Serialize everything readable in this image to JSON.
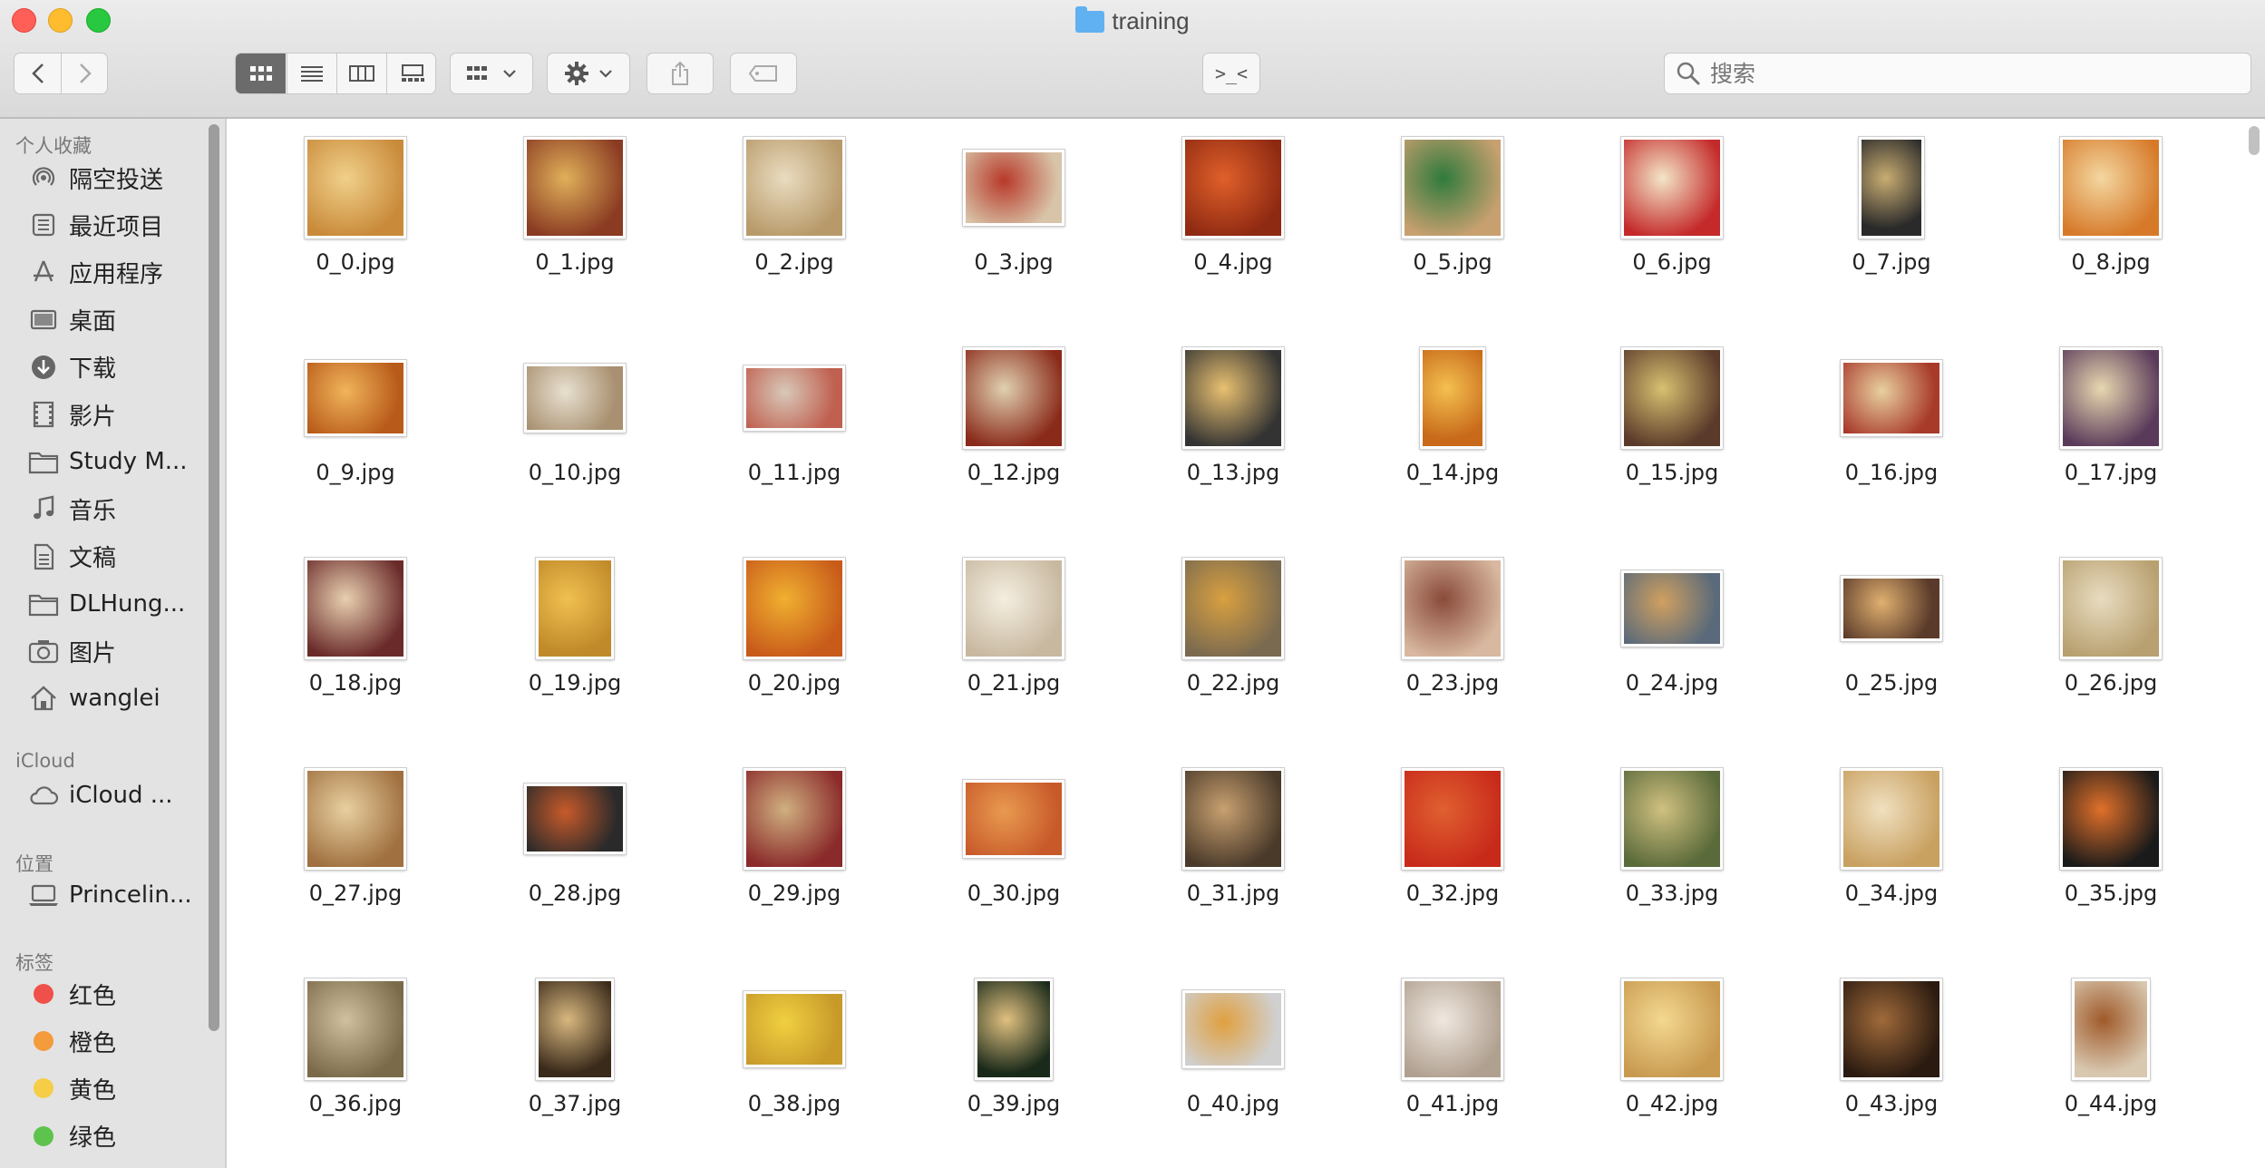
{
  "window": {
    "title": "training"
  },
  "toolbar": {
    "back_symbol": "‹",
    "forward_symbol": "›",
    "terminal_label": ">_<",
    "search": {
      "placeholder": "搜索",
      "value": ""
    }
  },
  "sidebar": {
    "sections": [
      {
        "heading": "个人收藏",
        "items": [
          {
            "label": "隔空投送",
            "icon": "airdrop-icon"
          },
          {
            "label": "最近项目",
            "icon": "recents-icon"
          },
          {
            "label": "应用程序",
            "icon": "applications-icon"
          },
          {
            "label": "桌面",
            "icon": "desktop-icon"
          },
          {
            "label": "下载",
            "icon": "downloads-icon"
          },
          {
            "label": "影片",
            "icon": "movies-icon"
          },
          {
            "label": "Study M...",
            "icon": "folder-icon"
          },
          {
            "label": "音乐",
            "icon": "music-icon"
          },
          {
            "label": "文稿",
            "icon": "documents-icon"
          },
          {
            "label": "DLHung...",
            "icon": "folder-icon"
          },
          {
            "label": "图片",
            "icon": "pictures-icon"
          },
          {
            "label": "wanglei",
            "icon": "home-icon"
          }
        ]
      },
      {
        "heading": "iCloud",
        "items": [
          {
            "label": "iCloud ...",
            "icon": "icloud-icon"
          }
        ]
      },
      {
        "heading": "位置",
        "items": [
          {
            "label": "Princelin...",
            "icon": "laptop-icon"
          }
        ]
      },
      {
        "heading": "标签",
        "items": [
          {
            "label": "红色",
            "icon": "tag-dot-icon",
            "color": "#f0504a"
          },
          {
            "label": "橙色",
            "icon": "tag-dot-icon",
            "color": "#f49b3c"
          },
          {
            "label": "黄色",
            "icon": "tag-dot-icon",
            "color": "#f6cd46"
          },
          {
            "label": "绿色",
            "icon": "tag-dot-icon",
            "color": "#5ec34c"
          }
        ]
      }
    ]
  },
  "files": [
    "0_0.jpg",
    "0_1.jpg",
    "0_2.jpg",
    "0_3.jpg",
    "0_4.jpg",
    "0_5.jpg",
    "0_6.jpg",
    "0_7.jpg",
    "0_8.jpg",
    "0_9.jpg",
    "0_10.jpg",
    "0_11.jpg",
    "0_12.jpg",
    "0_13.jpg",
    "0_14.jpg",
    "0_15.jpg",
    "0_16.jpg",
    "0_17.jpg",
    "0_18.jpg",
    "0_19.jpg",
    "0_20.jpg",
    "0_21.jpg",
    "0_22.jpg",
    "0_23.jpg",
    "0_24.jpg",
    "0_25.jpg",
    "0_26.jpg",
    "0_27.jpg",
    "0_28.jpg",
    "0_29.jpg",
    "0_30.jpg",
    "0_31.jpg",
    "0_32.jpg",
    "0_33.jpg",
    "0_34.jpg",
    "0_35.jpg",
    "0_36.jpg",
    "0_37.jpg",
    "0_38.jpg",
    "0_39.jpg",
    "0_40.jpg",
    "0_41.jpg",
    "0_42.jpg",
    "0_43.jpg",
    "0_44.jpg"
  ],
  "thumb_palette": [
    [
      "#c98a3a",
      "#f0d08a"
    ],
    [
      "#8a3b22",
      "#e0b05a"
    ],
    [
      "#b89a6a",
      "#e9dcc0"
    ],
    [
      "#d8c4a8",
      "#b8392a"
    ],
    [
      "#8f2a12",
      "#e0602a"
    ],
    [
      "#c8a070",
      "#2f7a3c"
    ],
    [
      "#c42a2a",
      "#f3e6c8"
    ],
    [
      "#2a2a2a",
      "#c9ad72"
    ],
    [
      "#d67a2a",
      "#f4d7a0"
    ],
    [
      "#b85a1a",
      "#f0b45a"
    ],
    [
      "#a89070",
      "#e8e0d0"
    ],
    [
      "#c06050",
      "#d8c8b8"
    ],
    [
      "#8a2a1a",
      "#e0d0b0"
    ],
    [
      "#333333",
      "#e8c070"
    ],
    [
      "#c86a1a",
      "#f4c050"
    ],
    [
      "#5a3a2a",
      "#d8c070"
    ],
    [
      "#a83a2a",
      "#e8d0a0"
    ],
    [
      "#5a3a5a",
      "#e8d8b0"
    ],
    [
      "#6a2a2a",
      "#e8d0b0"
    ],
    [
      "#c08a2a",
      "#f0c050"
    ],
    [
      "#c85a1a",
      "#f0b030"
    ],
    [
      "#c8b8a0",
      "#f4eee0"
    ],
    [
      "#7a6a50",
      "#d8a040"
    ],
    [
      "#d8b8a0",
      "#8a4a3a"
    ],
    [
      "#5a6a7a",
      "#d0a060"
    ],
    [
      "#5a3a2a",
      "#e0b070"
    ],
    [
      "#b8a070",
      "#e8dcc0"
    ],
    [
      "#a07040",
      "#e8d0a0"
    ],
    [
      "#2a2a2a",
      "#c85a2a"
    ],
    [
      "#8a2a2a",
      "#d0b080"
    ],
    [
      "#c85a2a",
      "#e89a50"
    ],
    [
      "#4a3a2a",
      "#c8a070"
    ],
    [
      "#c82a1a",
      "#e06030"
    ],
    [
      "#5a6a3a",
      "#d0c080"
    ],
    [
      "#c8a060",
      "#f0e0c0"
    ],
    [
      "#1a1a1a",
      "#e0702a"
    ],
    [
      "#7a6a4a",
      "#d0c0a0"
    ],
    [
      "#3a2a1a",
      "#d8b880"
    ],
    [
      "#c89a2a",
      "#f0d040"
    ],
    [
      "#1a2a1a",
      "#e0c080"
    ],
    [
      "#d0d0d0",
      "#e0a040"
    ],
    [
      "#b0a090",
      "#f0e8e0"
    ],
    [
      "#c89a50",
      "#f4d890"
    ],
    [
      "#2a1a10",
      "#a06a3a"
    ],
    [
      "#d8c8b0",
      "#a05a2a"
    ]
  ]
}
